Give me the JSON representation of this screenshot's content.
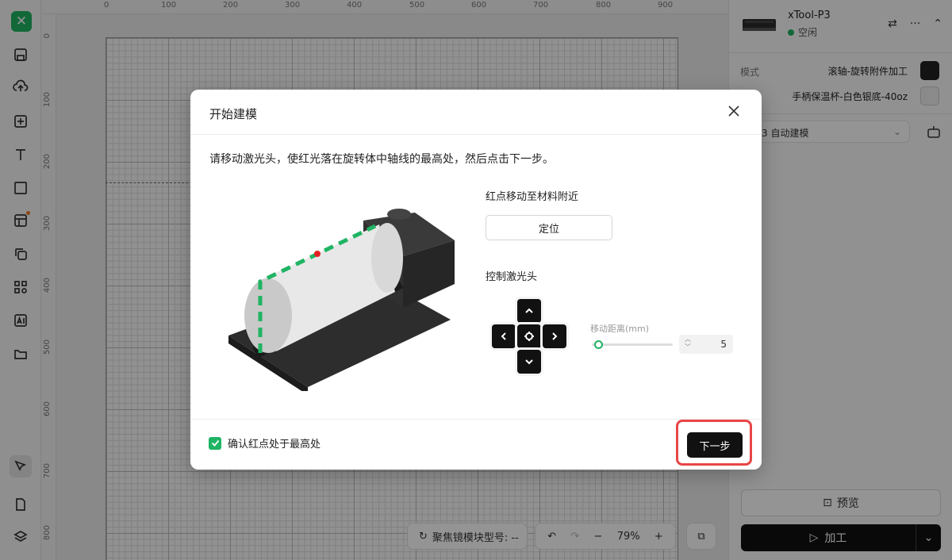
{
  "canvas": {
    "ruler_top_labels": [
      "0",
      "100",
      "200",
      "300",
      "400",
      "500",
      "600",
      "700",
      "800",
      "900"
    ],
    "ruler_left_labels": [
      "0",
      "100",
      "200",
      "300",
      "400",
      "500",
      "600",
      "700",
      "800"
    ],
    "focus_module": "聚焦镜模块型号: --",
    "zoom": "79%"
  },
  "device": {
    "name": "xTool-P3",
    "status": "空闲",
    "status_color": "#1fb463"
  },
  "settings": {
    "mode_label": "模式",
    "mode_value": "滚轴-旋转附件加工",
    "material_value": "手柄保温杯-白色银底-40oz",
    "model_select": "3 自动建模"
  },
  "actions": {
    "preview": "预览",
    "process": "加工"
  },
  "modal": {
    "title": "开始建模",
    "instruction": "请移动激光头，使红光落在旋转体中轴线的最高处，然后点击下一步。",
    "section_move_red_dot": "红点移动至材料附近",
    "position_button": "定位",
    "section_control_head": "控制激光头",
    "distance_label": "移动距离(mm)",
    "distance_value": "5",
    "distance_slider_fraction": 0.05,
    "confirm_label": "确认红点处于最高处",
    "confirm_checked": true,
    "next_button": "下一步",
    "highlight_color": "#e84545"
  }
}
